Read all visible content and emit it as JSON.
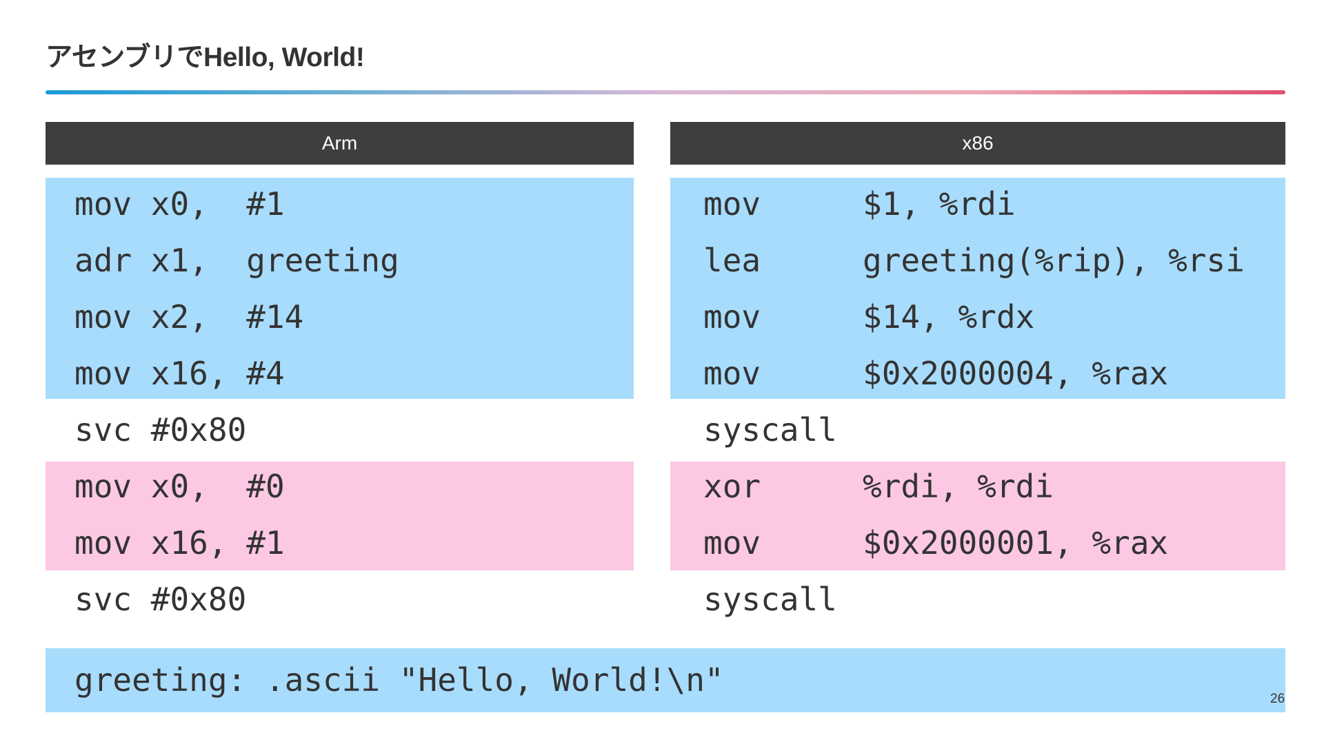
{
  "slide": {
    "title": "アセンブリでHello, World!",
    "page_number": "26",
    "colors": {
      "header_bg": "#3e3e3e",
      "highlight_blue": "#a8dcfc",
      "highlight_pink": "#fcc8e4",
      "rule_gradient": [
        "#1a9ad6",
        "#d8b8d6",
        "#e05070"
      ]
    }
  },
  "arm": {
    "header": "Arm",
    "lines": [
      {
        "op": "mov",
        "args": "x0,  #1"
      },
      {
        "op": "adr",
        "args": "x1,  greeting"
      },
      {
        "op": "mov",
        "args": "x2,  #14"
      },
      {
        "op": "mov",
        "args": "x16, #4"
      },
      {
        "op": "svc",
        "args": "#0x80"
      },
      {
        "op": "mov",
        "args": "x0,  #0"
      },
      {
        "op": "mov",
        "args": "x16, #1"
      },
      {
        "op": "svc",
        "args": "#0x80"
      }
    ]
  },
  "x86": {
    "header": "x86",
    "lines": [
      {
        "op": "mov",
        "args": "$1, %rdi"
      },
      {
        "op": "lea",
        "args": "greeting(%rip), %rsi"
      },
      {
        "op": "mov",
        "args": "$14, %rdx"
      },
      {
        "op": "mov",
        "args": "$0x2000004, %rax"
      },
      {
        "op": "syscall",
        "args": ""
      },
      {
        "op": "xor",
        "args": "%rdi, %rdi"
      },
      {
        "op": "mov",
        "args": "$0x2000001, %rax"
      },
      {
        "op": "syscall",
        "args": ""
      }
    ]
  },
  "data_section": {
    "line": "greeting: .ascii \"Hello, World!\\n\""
  }
}
